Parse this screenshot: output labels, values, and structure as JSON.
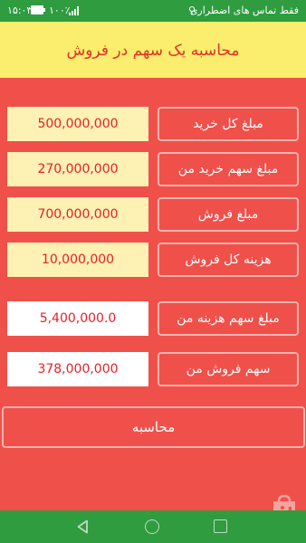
{
  "status_bar": {
    "time": "۱۵:۰۳",
    "battery": "۱۰۰٪",
    "carrier_text": "فقط تماس های اضطراری"
  },
  "title": "محاسبه یک سهم در فروش",
  "rows": [
    {
      "value": "500,000,000",
      "label": "مبلغ  کل خرید"
    },
    {
      "value": "270,000,000",
      "label": "مبلغ سهم خرید من"
    },
    {
      "value": "700,000,000",
      "label": "مبلغ فروش"
    },
    {
      "value": "10,000,000",
      "label": "هزینه کل فروش"
    },
    {
      "value": "5,400,000.0",
      "label": "مبلغ سهم هزینه من"
    },
    {
      "value": "378,000,000",
      "label": "سهم فروش من"
    }
  ],
  "calculate_label": "محاسبه",
  "colors": {
    "background": "#f0504a",
    "title_bar": "#fbed6d",
    "title_text": "#e0322a",
    "input_yellow": "#fdf1b3",
    "value_text": "#e8202a",
    "system_bars": "#2e9c3f"
  },
  "icons": [
    "battery-icon",
    "signal-icon",
    "usb-icon",
    "store-watermark-icon",
    "back-icon",
    "home-icon",
    "recent-apps-icon"
  ]
}
